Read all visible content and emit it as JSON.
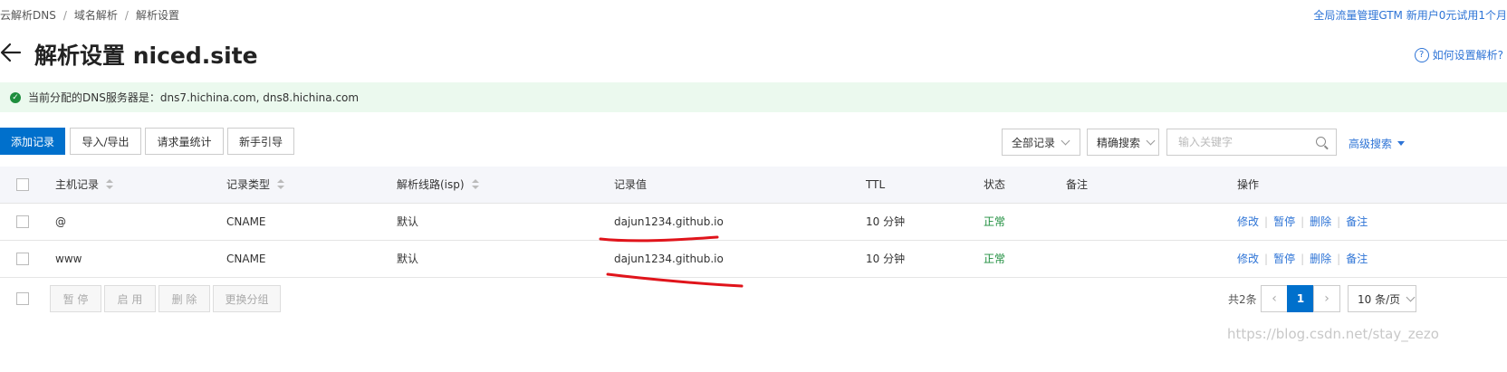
{
  "breadcrumb": {
    "items": [
      "云解析DNS",
      "域名解析",
      "解析设置"
    ],
    "separator": "/"
  },
  "promo_link": "全局流量管理GTM 新用户0元试用1个月",
  "page_title": "解析设置 niced.site",
  "help_link": "如何设置解析?",
  "help_icon_glyph": "?",
  "dns_banner": {
    "label": "当前分配的DNS服务器是：",
    "servers": "dns7.hichina.com, dns8.hichina.com"
  },
  "toolbar": {
    "add_record": "添加记录",
    "import_export": "导入/导出",
    "request_stats": "请求量统计",
    "beginner_guide": "新手引导",
    "record_filter": "全部记录",
    "search_mode": "精确搜索",
    "search_placeholder": "输入关键字",
    "advanced_search": "高级搜索"
  },
  "table": {
    "columns": [
      "主机记录",
      "记录类型",
      "解析线路(isp)",
      "记录值",
      "TTL",
      "状态",
      "备注",
      "操作"
    ],
    "rows": [
      {
        "host": "@",
        "type": "CNAME",
        "line": "默认",
        "value": "dajun1234.github.io",
        "ttl": "10 分钟",
        "status": "正常",
        "remark": ""
      },
      {
        "host": "www",
        "type": "CNAME",
        "line": "默认",
        "value": "dajun1234.github.io",
        "ttl": "10 分钟",
        "status": "正常",
        "remark": ""
      }
    ],
    "actions": [
      "修改",
      "暂停",
      "删除",
      "备注"
    ]
  },
  "bulk_actions": {
    "pause": "暂 停",
    "enable": "启 用",
    "delete": "删 除",
    "change_group": "更换分组"
  },
  "pagination": {
    "total": "共2条",
    "current_page": "1",
    "page_size": "10 条/页",
    "prev_glyph": "‹",
    "next_glyph": "›"
  },
  "watermark": "https://blog.csdn.net/stay_zezo",
  "colors": {
    "accent": "#0070cc",
    "link": "#2e74d6",
    "success": "#1e8e3e",
    "banner_bg": "#ebf9ee",
    "annotation": "#e0141b"
  }
}
